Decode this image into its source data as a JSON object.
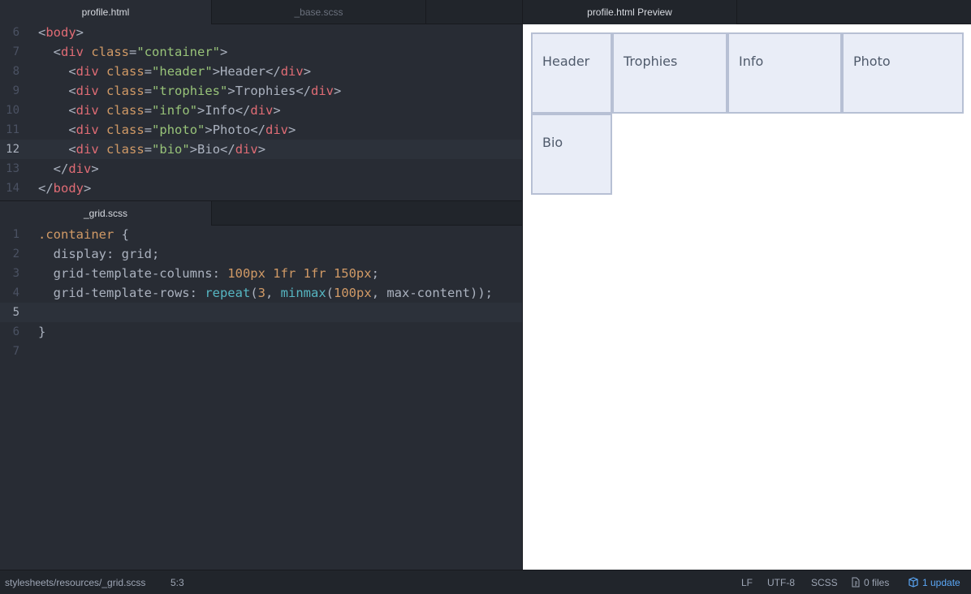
{
  "top_tabs": {
    "left": [
      {
        "label": "profile.html",
        "active": true
      },
      {
        "label": "_base.scss",
        "active": false
      },
      {
        "label": "",
        "active": false
      }
    ],
    "right": [
      {
        "label": "profile.html Preview",
        "active": false
      }
    ]
  },
  "html_editor": {
    "lines": [
      {
        "num": "6",
        "tokens": [
          [
            "p",
            "<"
          ],
          [
            "t",
            "body"
          ],
          [
            "p",
            ">"
          ]
        ]
      },
      {
        "num": "7",
        "tokens": [
          [
            "p",
            "  <"
          ],
          [
            "t",
            "div"
          ],
          [
            "p",
            " "
          ],
          [
            "a",
            "class"
          ],
          [
            "p",
            "="
          ],
          [
            "s",
            "\"container\""
          ],
          [
            "p",
            ">"
          ]
        ]
      },
      {
        "num": "8",
        "tokens": [
          [
            "p",
            "    <"
          ],
          [
            "t",
            "div"
          ],
          [
            "p",
            " "
          ],
          [
            "a",
            "class"
          ],
          [
            "p",
            "="
          ],
          [
            "s",
            "\"header\""
          ],
          [
            "p",
            ">Header</"
          ],
          [
            "t",
            "div"
          ],
          [
            "p",
            ">"
          ]
        ]
      },
      {
        "num": "9",
        "tokens": [
          [
            "p",
            "    <"
          ],
          [
            "t",
            "div"
          ],
          [
            "p",
            " "
          ],
          [
            "a",
            "class"
          ],
          [
            "p",
            "="
          ],
          [
            "s",
            "\"trophies\""
          ],
          [
            "p",
            ">Trophies</"
          ],
          [
            "t",
            "div"
          ],
          [
            "p",
            ">"
          ]
        ]
      },
      {
        "num": "10",
        "tokens": [
          [
            "p",
            "    <"
          ],
          [
            "t",
            "div"
          ],
          [
            "p",
            " "
          ],
          [
            "a",
            "class"
          ],
          [
            "p",
            "="
          ],
          [
            "s",
            "\"info\""
          ],
          [
            "p",
            ">Info</"
          ],
          [
            "t",
            "div"
          ],
          [
            "p",
            ">"
          ]
        ]
      },
      {
        "num": "11",
        "tokens": [
          [
            "p",
            "    <"
          ],
          [
            "t",
            "div"
          ],
          [
            "p",
            " "
          ],
          [
            "a",
            "class"
          ],
          [
            "p",
            "="
          ],
          [
            "s",
            "\"photo\""
          ],
          [
            "p",
            ">Photo</"
          ],
          [
            "t",
            "div"
          ],
          [
            "p",
            ">"
          ]
        ]
      },
      {
        "num": "12",
        "current": true,
        "tokens": [
          [
            "p",
            "    <"
          ],
          [
            "t",
            "div"
          ],
          [
            "p",
            " "
          ],
          [
            "a",
            "class"
          ],
          [
            "p",
            "="
          ],
          [
            "s",
            "\"bio\""
          ],
          [
            "p",
            ">Bio</"
          ],
          [
            "t",
            "div"
          ],
          [
            "p",
            ">"
          ]
        ]
      },
      {
        "num": "13",
        "tokens": [
          [
            "p",
            "  </"
          ],
          [
            "t",
            "div"
          ],
          [
            "p",
            ">"
          ]
        ]
      },
      {
        "num": "14",
        "tokens": [
          [
            "p",
            "</"
          ],
          [
            "t",
            "body"
          ],
          [
            "p",
            ">"
          ]
        ]
      }
    ]
  },
  "scss_tab": {
    "label": "_grid.scss"
  },
  "scss_editor": {
    "lines": [
      {
        "num": "1",
        "tokens": [
          [
            "a",
            ".container"
          ],
          [
            "p",
            " {"
          ]
        ]
      },
      {
        "num": "2",
        "tokens": [
          [
            "p",
            "  display: grid;"
          ]
        ]
      },
      {
        "num": "3",
        "tokens": [
          [
            "p",
            "  grid-template-columns: "
          ],
          [
            "n",
            "100px 1fr 1fr 150px"
          ],
          [
            "p",
            ";"
          ]
        ]
      },
      {
        "num": "4",
        "tokens": [
          [
            "p",
            "  grid-template-rows: "
          ],
          [
            "f",
            "repeat"
          ],
          [
            "p",
            "("
          ],
          [
            "n",
            "3"
          ],
          [
            "p",
            ", "
          ],
          [
            "f",
            "minmax"
          ],
          [
            "p",
            "("
          ],
          [
            "n",
            "100px"
          ],
          [
            "p",
            ", max-content));"
          ]
        ]
      },
      {
        "num": "5",
        "current": true,
        "tokens": [
          [
            "p",
            ""
          ]
        ]
      },
      {
        "num": "6",
        "tokens": [
          [
            "p",
            "}"
          ]
        ]
      },
      {
        "num": "7",
        "tokens": [
          [
            "p",
            ""
          ]
        ]
      }
    ]
  },
  "preview": {
    "cells": [
      "Header",
      "Trophies",
      "Info",
      "Photo",
      "Bio"
    ]
  },
  "statusbar": {
    "file_path": "stylesheets/resources/_grid.scss",
    "cursor": "5:3",
    "line_ending": "LF",
    "encoding": "UTF-8",
    "grammar": "SCSS",
    "git_files": "0 files",
    "updates": "1 update"
  },
  "colors": {
    "editor_bg": "#282c34",
    "tabbar_bg": "#21252b",
    "accent": "#5aa6f5",
    "cell_bg": "#e9edf7",
    "cell_border": "#b7c0d4"
  }
}
